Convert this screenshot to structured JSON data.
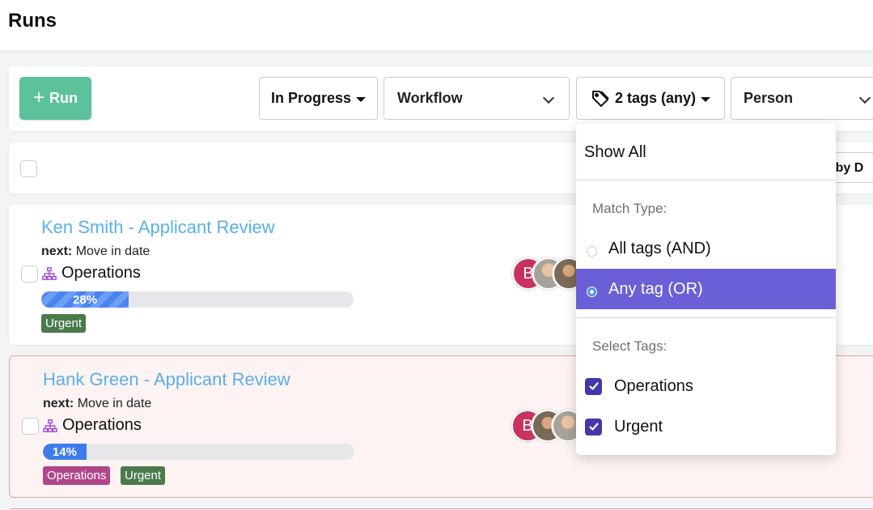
{
  "page": {
    "title": "Runs"
  },
  "toolbar": {
    "run_label": "Run",
    "status_filter": "In Progress",
    "workflow_filter": "Workflow",
    "tags_filter": "2 tags (any)",
    "person_filter": "Person"
  },
  "bulk": {
    "sort_label": "er by D"
  },
  "runs": [
    {
      "title": "Ken Smith - Applicant Review",
      "next_label": "next:",
      "next_value": "Move in date",
      "workflow": "Operations",
      "progress": 28,
      "progress_label": "28%",
      "tags": [
        "Urgent"
      ],
      "avatar_initial": "B"
    },
    {
      "title": "Hank Green - Applicant Review",
      "next_label": "next:",
      "next_value": "Move in date",
      "workflow": "Operations",
      "progress": 14,
      "progress_label": "14%",
      "tags": [
        "Operations",
        "Urgent"
      ],
      "avatar_initial": "B"
    }
  ],
  "tags_dropdown": {
    "show_all": "Show All",
    "match_type_label": "Match Type:",
    "match_options": [
      {
        "label": "All tags (AND)",
        "selected": false
      },
      {
        "label": "Any tag (OR)",
        "selected": true
      }
    ],
    "select_tags_label": "Select Tags:",
    "tags": [
      {
        "label": "Operations",
        "checked": true
      },
      {
        "label": "Urgent",
        "checked": true
      }
    ]
  },
  "colors": {
    "run_button": "#5cc29a",
    "title_link": "#5ab0e8",
    "selected_option": "#6b5fd8",
    "tag_urgent": "#4b7a4c",
    "tag_operations": "#b0458a",
    "checkbox_checked": "#4338a8"
  },
  "icons": {
    "workflow": "sitemap-icon",
    "tags": "tag-icon",
    "run": "plus-icon"
  }
}
